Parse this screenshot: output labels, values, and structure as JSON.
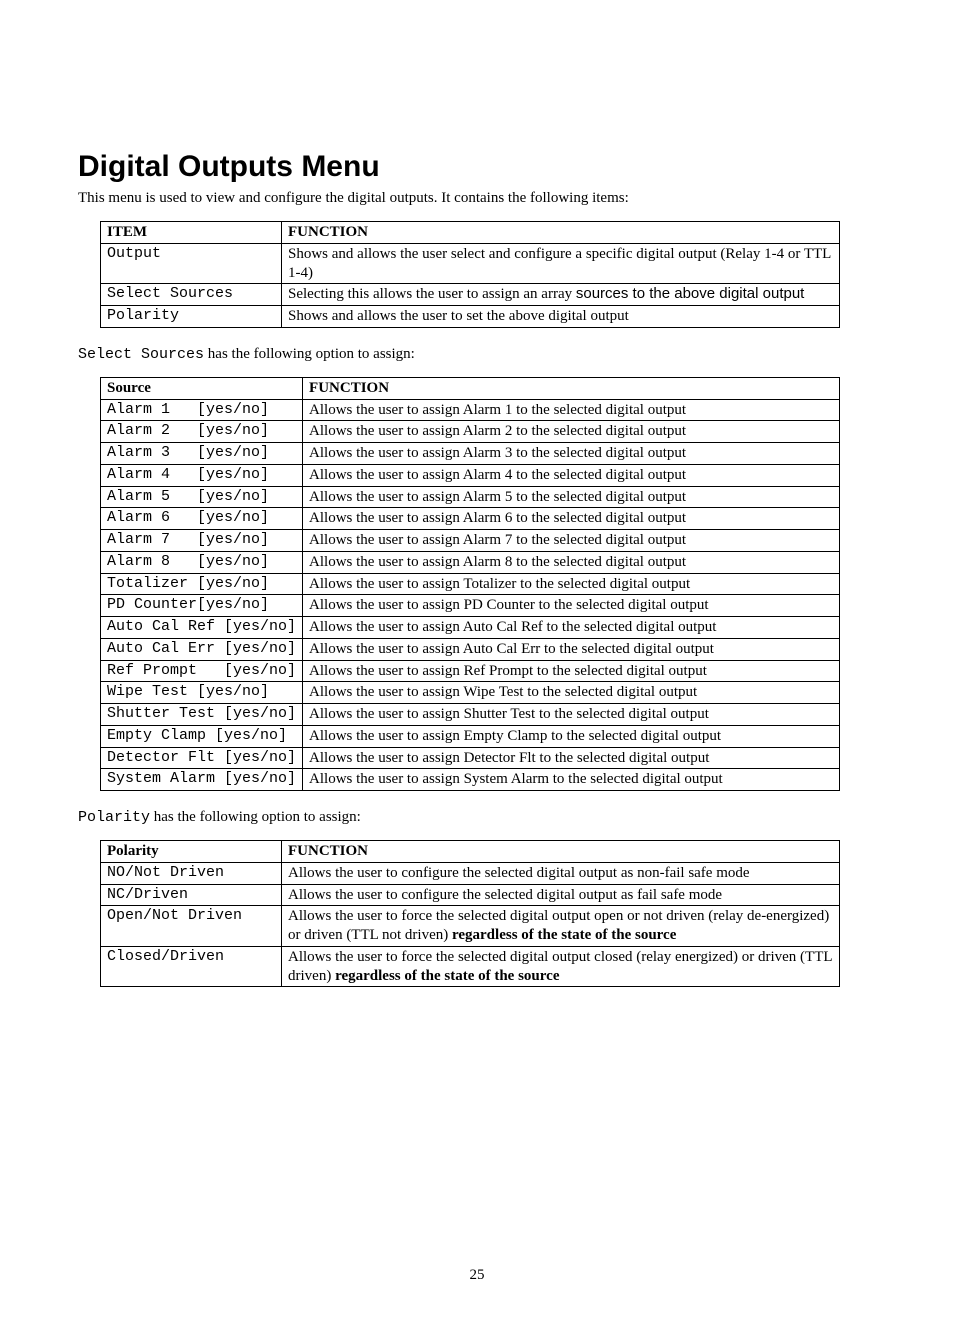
{
  "title": "Digital Outputs Menu",
  "intro": "This menu is used to view and configure the digital outputs.  It contains the following items:",
  "table1": {
    "h1": "ITEM",
    "h2": "FUNCTION",
    "rows": [
      {
        "item": "Output",
        "plain1": "Shows and allows the user select and configure a specific digital output (Relay 1-4 or TTL 1-4)"
      },
      {
        "item": "Select Sources",
        "plain1": "Selecting this allows the user to assign an array ",
        "sans": "sources to the above digital output",
        "plain2": ""
      },
      {
        "item": "Polarity",
        "plain1": "Shows and allows the user to set the above digital output"
      }
    ]
  },
  "para1_pre": "Select Sources",
  "para1_post": " has the following option to assign:",
  "table2": {
    "h1": "Source",
    "h2": "FUNCTION",
    "rows": [
      {
        "item": "Alarm 1   [yes/no]",
        "func": "Allows the user to assign Alarm 1 to the selected digital output"
      },
      {
        "item": "Alarm 2   [yes/no]",
        "func": "Allows the user to assign Alarm 2 to the selected digital output"
      },
      {
        "item": "Alarm 3   [yes/no]",
        "func": "Allows the user to assign Alarm 3 to the selected digital output"
      },
      {
        "item": "Alarm 4   [yes/no]",
        "func": "Allows the user to assign Alarm 4 to the selected digital output"
      },
      {
        "item": "Alarm 5   [yes/no]",
        "func": "Allows the user to assign Alarm 5 to the selected digital output"
      },
      {
        "item": "Alarm 6   [yes/no]",
        "func": "Allows the user to assign Alarm 6 to the selected digital output"
      },
      {
        "item": "Alarm 7   [yes/no]",
        "func": "Allows the user to assign Alarm 7 to the selected digital output"
      },
      {
        "item": "Alarm 8   [yes/no]",
        "func": "Allows the user to assign Alarm 8 to the selected digital output"
      },
      {
        "item": "Totalizer [yes/no]",
        "func": "Allows the user to assign Totalizer to the selected digital output"
      },
      {
        "item": "PD Counter[yes/no]",
        "func": "Allows the user to assign PD Counter to the selected digital output"
      },
      {
        "item": "Auto Cal Ref [yes/no]",
        "func": "Allows the user to assign Auto Cal Ref to the selected digital output"
      },
      {
        "item": "Auto Cal Err [yes/no]",
        "func": "Allows the user to assign Auto Cal Err to the selected digital output"
      },
      {
        "item": "Ref Prompt   [yes/no]",
        "func": "Allows the user to assign Ref Prompt to the selected digital output"
      },
      {
        "item": "Wipe Test [yes/no]",
        "func": "Allows the user to assign Wipe Test to the selected digital output"
      },
      {
        "item": "Shutter Test [yes/no]",
        "func": "Allows the user to assign Shutter Test to the selected digital output"
      },
      {
        "item": "Empty Clamp [yes/no]",
        "func": "Allows the user to assign Empty Clamp to the selected digital output"
      },
      {
        "item": "Detector Flt [yes/no]",
        "func": "Allows the user to assign Detector Flt to the selected digital output"
      },
      {
        "item": "System Alarm [yes/no]",
        "func": "Allows the user to assign System Alarm to the selected digital output"
      }
    ]
  },
  "para2_pre": "Polarity",
  "para2_post": " has the following option to assign:",
  "table3": {
    "h1": "Polarity",
    "h2": "FUNCTION",
    "rows": [
      {
        "item": "NO/Not Driven",
        "plain1": "Allows the user to configure the selected digital output as non-fail safe mode"
      },
      {
        "item": "NC/Driven",
        "plain1": "Allows the user to configure the selected digital output as fail safe mode"
      },
      {
        "item": "Open/Not Driven",
        "plain1": "Allows the user to force the selected digital output open or not driven (relay de-energized) or driven (TTL not driven) ",
        "bold": "regardless of the state of the source"
      },
      {
        "item": "Closed/Driven",
        "plain1": "Allows the user to force the selected digital output closed  (relay energized) or driven (TTL driven) ",
        "bold": "regardless of the state of the source"
      }
    ]
  },
  "pagenum": "25"
}
